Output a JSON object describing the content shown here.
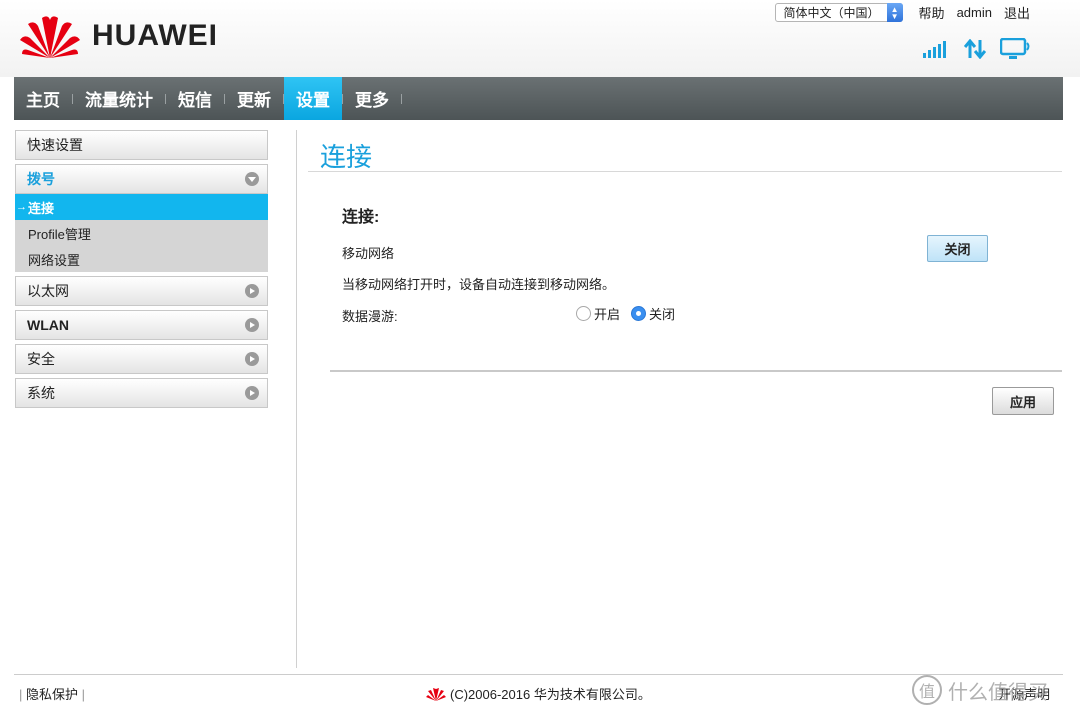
{
  "header": {
    "brand": "HUAWEI",
    "language": "简体中文（中国）",
    "help": "帮助",
    "user": "admin",
    "logout": "退出",
    "status_icons": [
      "signal-icon",
      "data-transfer-icon",
      "pc-connected-icon"
    ]
  },
  "nav": {
    "items": [
      {
        "label": "主页",
        "active": false
      },
      {
        "label": "流量统计",
        "active": false
      },
      {
        "label": "短信",
        "active": false
      },
      {
        "label": "更新",
        "active": false
      },
      {
        "label": "设置",
        "active": true
      },
      {
        "label": "更多",
        "active": false
      }
    ]
  },
  "sidebar": {
    "quick_setup": "快速设置",
    "dialup": "拨号",
    "dialup_items": [
      {
        "label": "连接",
        "active": true
      },
      {
        "label": "Profile管理",
        "active": false
      },
      {
        "label": "网络设置",
        "active": false
      }
    ],
    "ethernet": "以太网",
    "wlan": "WLAN",
    "security": "安全",
    "system": "系统"
  },
  "main": {
    "page_title": "连接",
    "section_title": "连接:",
    "mobile_network_label": "移动网络",
    "mobile_network_button": "关闭",
    "description": "当移动网络打开时，设备自动连接到移动网络。",
    "roaming_label": "数据漫游:",
    "roaming_on": "开启",
    "roaming_off": "关闭",
    "roaming_selected": "关闭",
    "apply_button": "应用"
  },
  "footer": {
    "privacy": "隐私保护",
    "copyright": "(C)2006-2016 华为技术有限公司。",
    "right_text": "开源声明",
    "watermark": "什么值得买",
    "watermark_char": "值"
  },
  "colors": {
    "accent": "#12b6ee",
    "nav_bg": "#5a6163",
    "brand_red": "#e60012",
    "title_blue": "#1aa0dc"
  }
}
